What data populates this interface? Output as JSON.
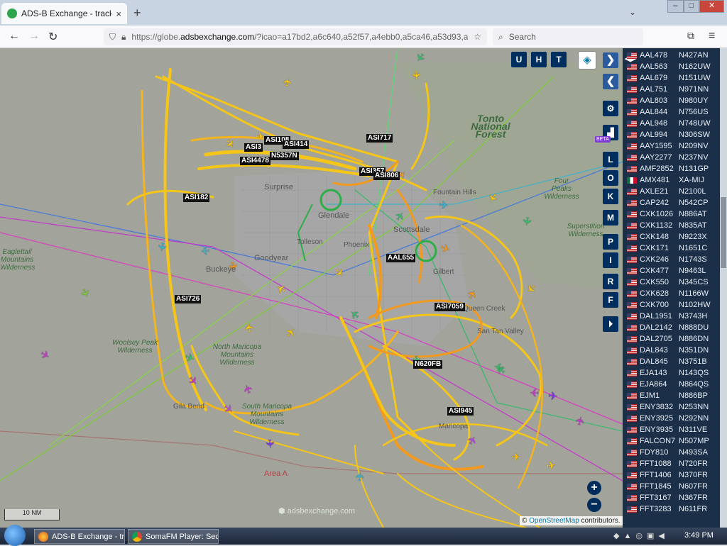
{
  "browser": {
    "tab_title": "ADS-B Exchange - track aircraft",
    "tab_close": "×",
    "new_tab": "+",
    "url_prefix": "https://globe.",
    "url_domain": "adsbexchange.com",
    "url_rest": "/?icao=a17bd2,a6c640,a52f57,a4ebb0,a5ca46,a53d93,ada546",
    "search_placeholder": "Search",
    "win_min": "–",
    "win_max": "□",
    "win_close": "✕"
  },
  "map": {
    "top_buttons": [
      "U",
      "H",
      "T"
    ],
    "side_buttons": [
      "L",
      "O",
      "K",
      "M",
      "P",
      "I",
      "R",
      "F"
    ],
    "beta_badge": "BETA",
    "zoom_in": "+",
    "zoom_out": "−",
    "scale_text": "10 NM",
    "brand_text": "adsbexchange.com",
    "attribution_prefix": "© ",
    "attribution_link": "OpenStreetMap",
    "attribution_suffix": " contributors.",
    "place_labels": [
      {
        "text": "Tonto National Forest",
        "cls": "forest"
      },
      {
        "text": "Four Peaks Wilderness"
      },
      {
        "text": "Superstition Wilderness"
      },
      {
        "text": "Eaglettail Mountains Wilderness"
      },
      {
        "text": "Woolsey Peak Wilderness"
      },
      {
        "text": "North Maricopa Mountains Wilderness"
      },
      {
        "text": "South Maricopa Mountains Wilderness"
      },
      {
        "text": "Area A"
      },
      {
        "text": "Surprise"
      },
      {
        "text": "Goodyear"
      },
      {
        "text": "Buckeye"
      },
      {
        "text": "Tolleson"
      },
      {
        "text": "Glendale"
      },
      {
        "text": "Scottsdale"
      },
      {
        "text": "Fountain Hills"
      },
      {
        "text": "Queen Creek"
      },
      {
        "text": "San Tan Valley"
      },
      {
        "text": "Gila Bend"
      },
      {
        "text": "Maricopa"
      },
      {
        "text": "Gilbert"
      },
      {
        "text": "Phoenix"
      }
    ],
    "aircraft_labels": [
      "ASI108",
      "ASI414",
      "ASI3",
      "N5357N",
      "ASI4478",
      "ASI717",
      "ASI357",
      "ASI806",
      "ASI182",
      "AAL655",
      "ASI726",
      "ASI7059",
      "N620FB",
      "ASI945"
    ]
  },
  "sidebar": {
    "rows": [
      {
        "callsign": "AAL478",
        "reg": "N427AN"
      },
      {
        "callsign": "AAL563",
        "reg": "N162UW"
      },
      {
        "callsign": "AAL679",
        "reg": "N151UW"
      },
      {
        "callsign": "AAL751",
        "reg": "N971NN"
      },
      {
        "callsign": "AAL803",
        "reg": "N980UY"
      },
      {
        "callsign": "AAL844",
        "reg": "N756US"
      },
      {
        "callsign": "AAL948",
        "reg": "N748UW"
      },
      {
        "callsign": "AAL994",
        "reg": "N306SW"
      },
      {
        "callsign": "AAY1595",
        "reg": "N209NV"
      },
      {
        "callsign": "AAY2277",
        "reg": "N237NV"
      },
      {
        "callsign": "AMF2852",
        "reg": "N131GP"
      },
      {
        "callsign": "AMX481",
        "reg": "XA-MIJ",
        "flag": "mx"
      },
      {
        "callsign": "AXLE21",
        "reg": "N2100L"
      },
      {
        "callsign": "CAP242",
        "reg": "N542CP"
      },
      {
        "callsign": "CXK1026",
        "reg": "N886AT"
      },
      {
        "callsign": "CXK1132",
        "reg": "N835AT"
      },
      {
        "callsign": "CXK148",
        "reg": "N9223X"
      },
      {
        "callsign": "CXK171",
        "reg": "N1651C"
      },
      {
        "callsign": "CXK246",
        "reg": "N1743S"
      },
      {
        "callsign": "CXK477",
        "reg": "N9463L"
      },
      {
        "callsign": "CXK550",
        "reg": "N345CS"
      },
      {
        "callsign": "CXK628",
        "reg": "N1166W"
      },
      {
        "callsign": "CXK700",
        "reg": "N102HW"
      },
      {
        "callsign": "DAL1951",
        "reg": "N3743H"
      },
      {
        "callsign": "DAL2142",
        "reg": "N888DU"
      },
      {
        "callsign": "DAL2705",
        "reg": "N886DN"
      },
      {
        "callsign": "DAL843",
        "reg": "N351DN"
      },
      {
        "callsign": "DAL845",
        "reg": "N3751B"
      },
      {
        "callsign": "EJA143",
        "reg": "N143QS"
      },
      {
        "callsign": "EJA864",
        "reg": "N864QS"
      },
      {
        "callsign": "EJM1",
        "reg": "N886BP"
      },
      {
        "callsign": "ENY3832",
        "reg": "N253NN"
      },
      {
        "callsign": "ENY3925",
        "reg": "N292NN"
      },
      {
        "callsign": "ENY3935",
        "reg": "N311VE"
      },
      {
        "callsign": "FALCON7",
        "reg": "N507MP"
      },
      {
        "callsign": "FDY810",
        "reg": "N493SA"
      },
      {
        "callsign": "FFT1088",
        "reg": "N720FR"
      },
      {
        "callsign": "FFT1406",
        "reg": "N370FR"
      },
      {
        "callsign": "FFT1845",
        "reg": "N607FR"
      },
      {
        "callsign": "FFT3167",
        "reg": "N367FR"
      },
      {
        "callsign": "FFT3283",
        "reg": "N611FR"
      }
    ]
  },
  "taskbar": {
    "items": [
      "ADS-B Exchange - tr...",
      "SomaFM Player: Secr..."
    ],
    "time": "3:49 PM"
  },
  "colors": {
    "track_yellow": "#f5c518",
    "track_orange": "#f39a1e",
    "sidebar_bg": "#1b2f48",
    "button_bg": "#002f5f"
  }
}
